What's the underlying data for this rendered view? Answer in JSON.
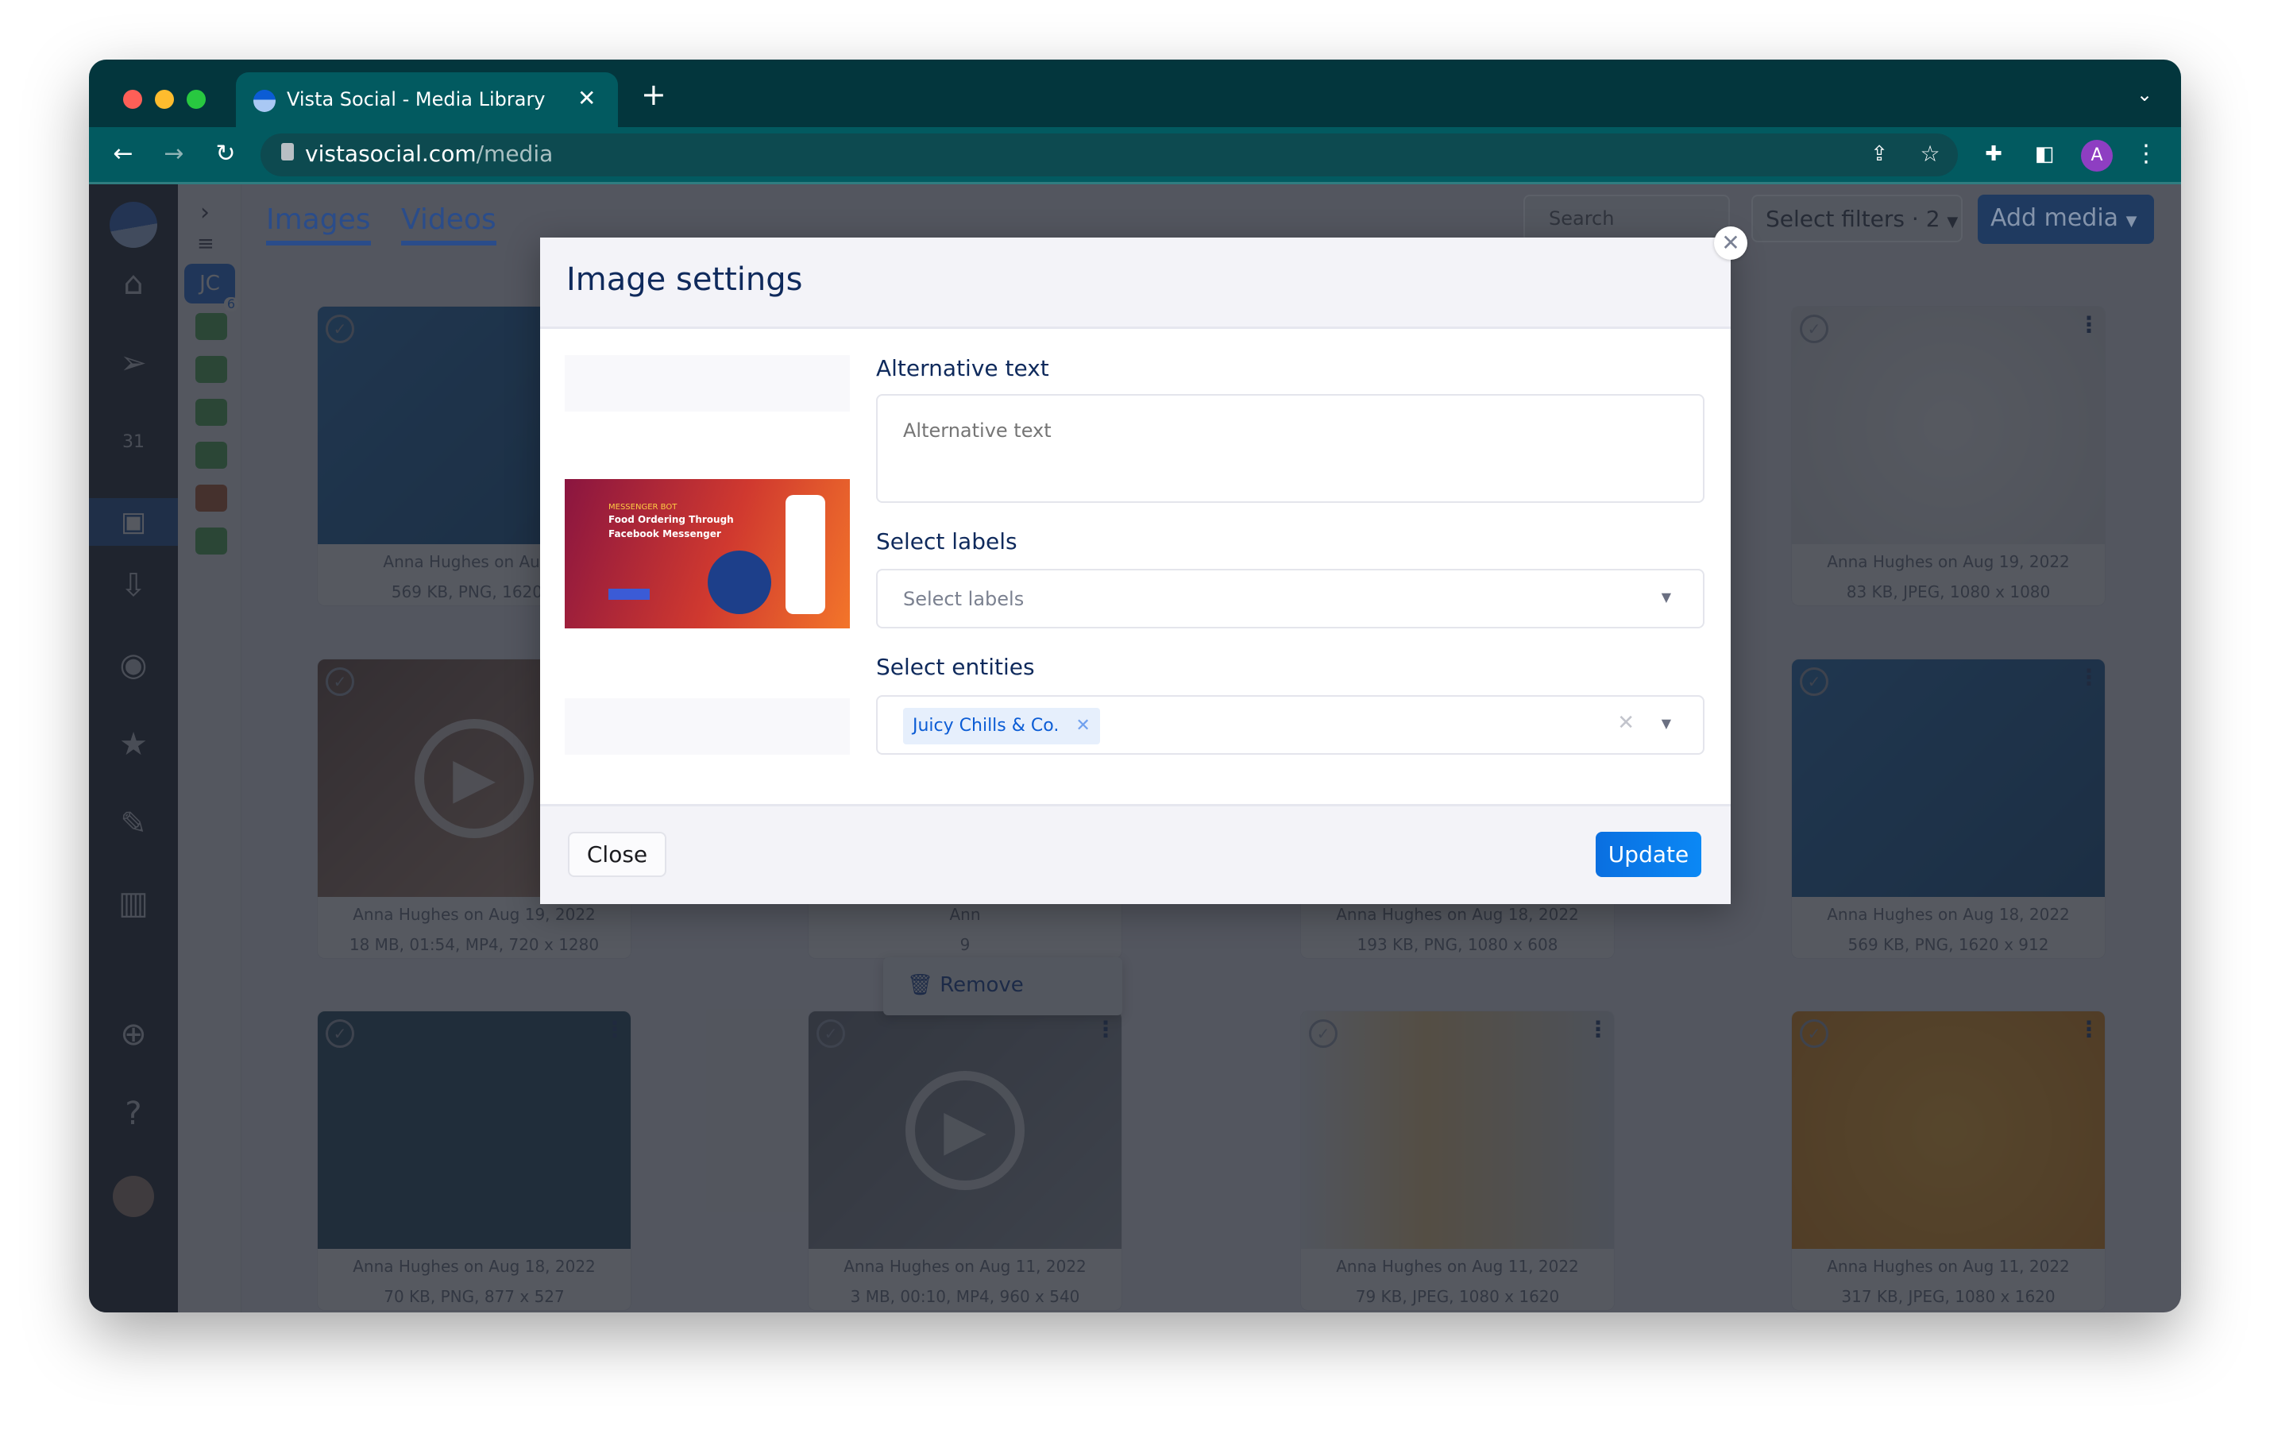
{
  "browser": {
    "tab_title": "Vista Social - Media Library",
    "url_domain": "vistasocial.com",
    "url_path": "/media",
    "profile_initial": "A",
    "profile_color": "#8e3ec2"
  },
  "app": {
    "brand_color": "#0b5cd5",
    "sidebar_items": [
      "home-icon",
      "send-icon",
      "calendar-icon",
      "media-icon",
      "inbox-icon",
      "listening-icon",
      "reviews-icon",
      "pin-icon",
      "reports-icon"
    ],
    "calendar_day": "31",
    "active_item": "media-icon",
    "account_initials": "JC",
    "account_count": "6",
    "tabs": [
      "Images",
      "Videos"
    ],
    "search_placeholder": "Search",
    "filters_label": "Select filters · 2",
    "add_media_label": "Add media",
    "context_menu": {
      "remove_label": "Remove"
    },
    "cards": [
      {
        "line1": "Anna Hughes on Aug 3",
        "line2": "569 KB, PNG, 1620 x"
      },
      {
        "line1": "",
        "line2": ""
      },
      {
        "line1": "",
        "line2": ""
      },
      {
        "line1": "Anna Hughes on Aug 19, 2022",
        "line2": "83 KB, JPEG, 1080 x 1080"
      },
      {
        "line1": "Anna Hughes on Aug 19, 2022",
        "line2": "18 MB, 01:54, MP4, 720 x 1280"
      },
      {
        "line1": "Ann",
        "line2": "9"
      },
      {
        "line1": "Anna Hughes on Aug 18, 2022",
        "line2": "193 KB, PNG, 1080 x 608"
      },
      {
        "line1": "Anna Hughes on Aug 18, 2022",
        "line2": "569 KB, PNG, 1620 x 912"
      },
      {
        "line1": "Anna Hughes on Aug 18, 2022",
        "line2": "70 KB, PNG, 877 x 527"
      },
      {
        "line1": "Anna Hughes on Aug 11, 2022",
        "line2": "3 MB, 00:10, MP4, 960 x 540"
      },
      {
        "line1": "Anna Hughes on Aug 11, 2022",
        "line2": "79 KB, JPEG, 1080 x 1620"
      },
      {
        "line1": "Anna Hughes on Aug 11, 2022",
        "line2": "317 KB, JPEG, 1080 x 1620"
      }
    ]
  },
  "modal": {
    "title": "Image settings",
    "thumbnail": {
      "tag": "MESSENGER BOT",
      "line1": "Food Ordering Through",
      "line2": "Facebook Messenger"
    },
    "alt_text_label": "Alternative text",
    "alt_text_placeholder": "Alternative text",
    "alt_text_value": "",
    "labels_label": "Select labels",
    "labels_placeholder": "Select labels",
    "entities_label": "Select entities",
    "entities_selected": [
      "Juicy Chills & Co."
    ],
    "close_label": "Close",
    "update_label": "Update",
    "update_color": "#0a74e6"
  }
}
